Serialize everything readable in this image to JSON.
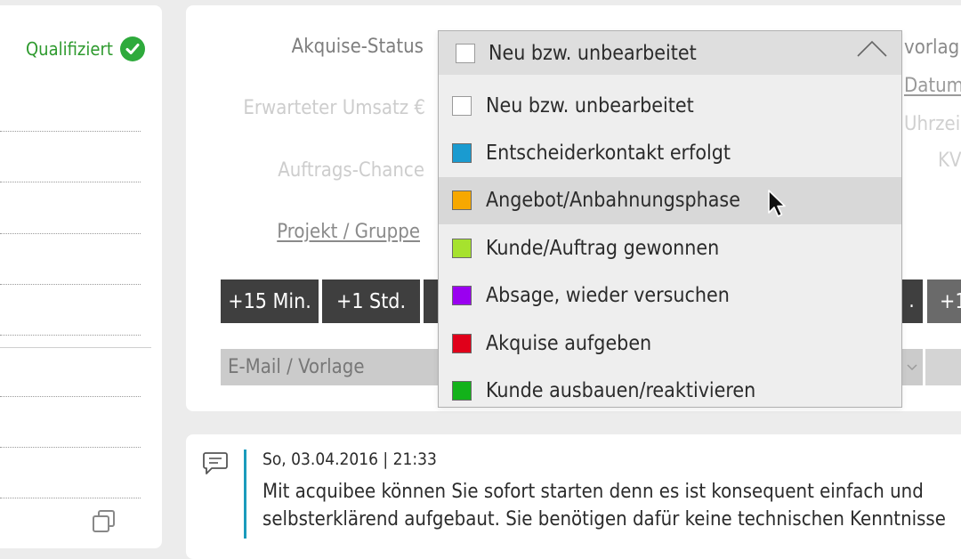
{
  "sidebar": {
    "status_text": "Qualifiziert",
    "status_icon": "check-circle-icon",
    "copy_icon": "copy-icon"
  },
  "form": {
    "labels": {
      "akquise_status": "Akquise-Status",
      "erwarteter_umsatz": "Erwarteter Umsatz €",
      "auftrags_chance": "Auftrags-Chance",
      "projekt_gruppe": "Projekt / Gruppe"
    },
    "quick_buttons": [
      "+15 Min.",
      "+1 Std."
    ],
    "quick_button_right_partial": ".",
    "quick_button_far_right_partial": "+1",
    "email_placeholder": "E-Mail / Vorlage",
    "right_labels": {
      "vorlag": "vorlag",
      "datum": "Datum",
      "uhrzeit": "Uhrzei",
      "kv": "KV"
    }
  },
  "dropdown": {
    "selected": "Neu bzw. unbearbeitet",
    "selected_color": "#ffffff",
    "options": [
      {
        "label": "Neu bzw. unbearbeitet",
        "color": "#ffffff"
      },
      {
        "label": "Entscheiderkontakt erfolgt",
        "color": "#1a9bd0"
      },
      {
        "label": "Angebot/Anbahnungsphase",
        "color": "#f7a800"
      },
      {
        "label": "Kunde/Auftrag gewonnen",
        "color": "#a6e22e"
      },
      {
        "label": "Absage, wieder versuchen",
        "color": "#9a00f0"
      },
      {
        "label": "Akquise aufgeben",
        "color": "#e0001a"
      },
      {
        "label": "Kunde ausbauen/reaktivieren",
        "color": "#13b21a"
      }
    ],
    "hovered_index": 2
  },
  "note": {
    "icon": "comment-icon",
    "timestamp": "So, 03.04.2016 | 21:33",
    "line1": "Mit acquibee können Sie sofort starten denn es ist konsequent einfach und",
    "line2": "selbsterklärend aufgebaut. Sie benötigen dafür keine technischen Kenntnisse"
  }
}
